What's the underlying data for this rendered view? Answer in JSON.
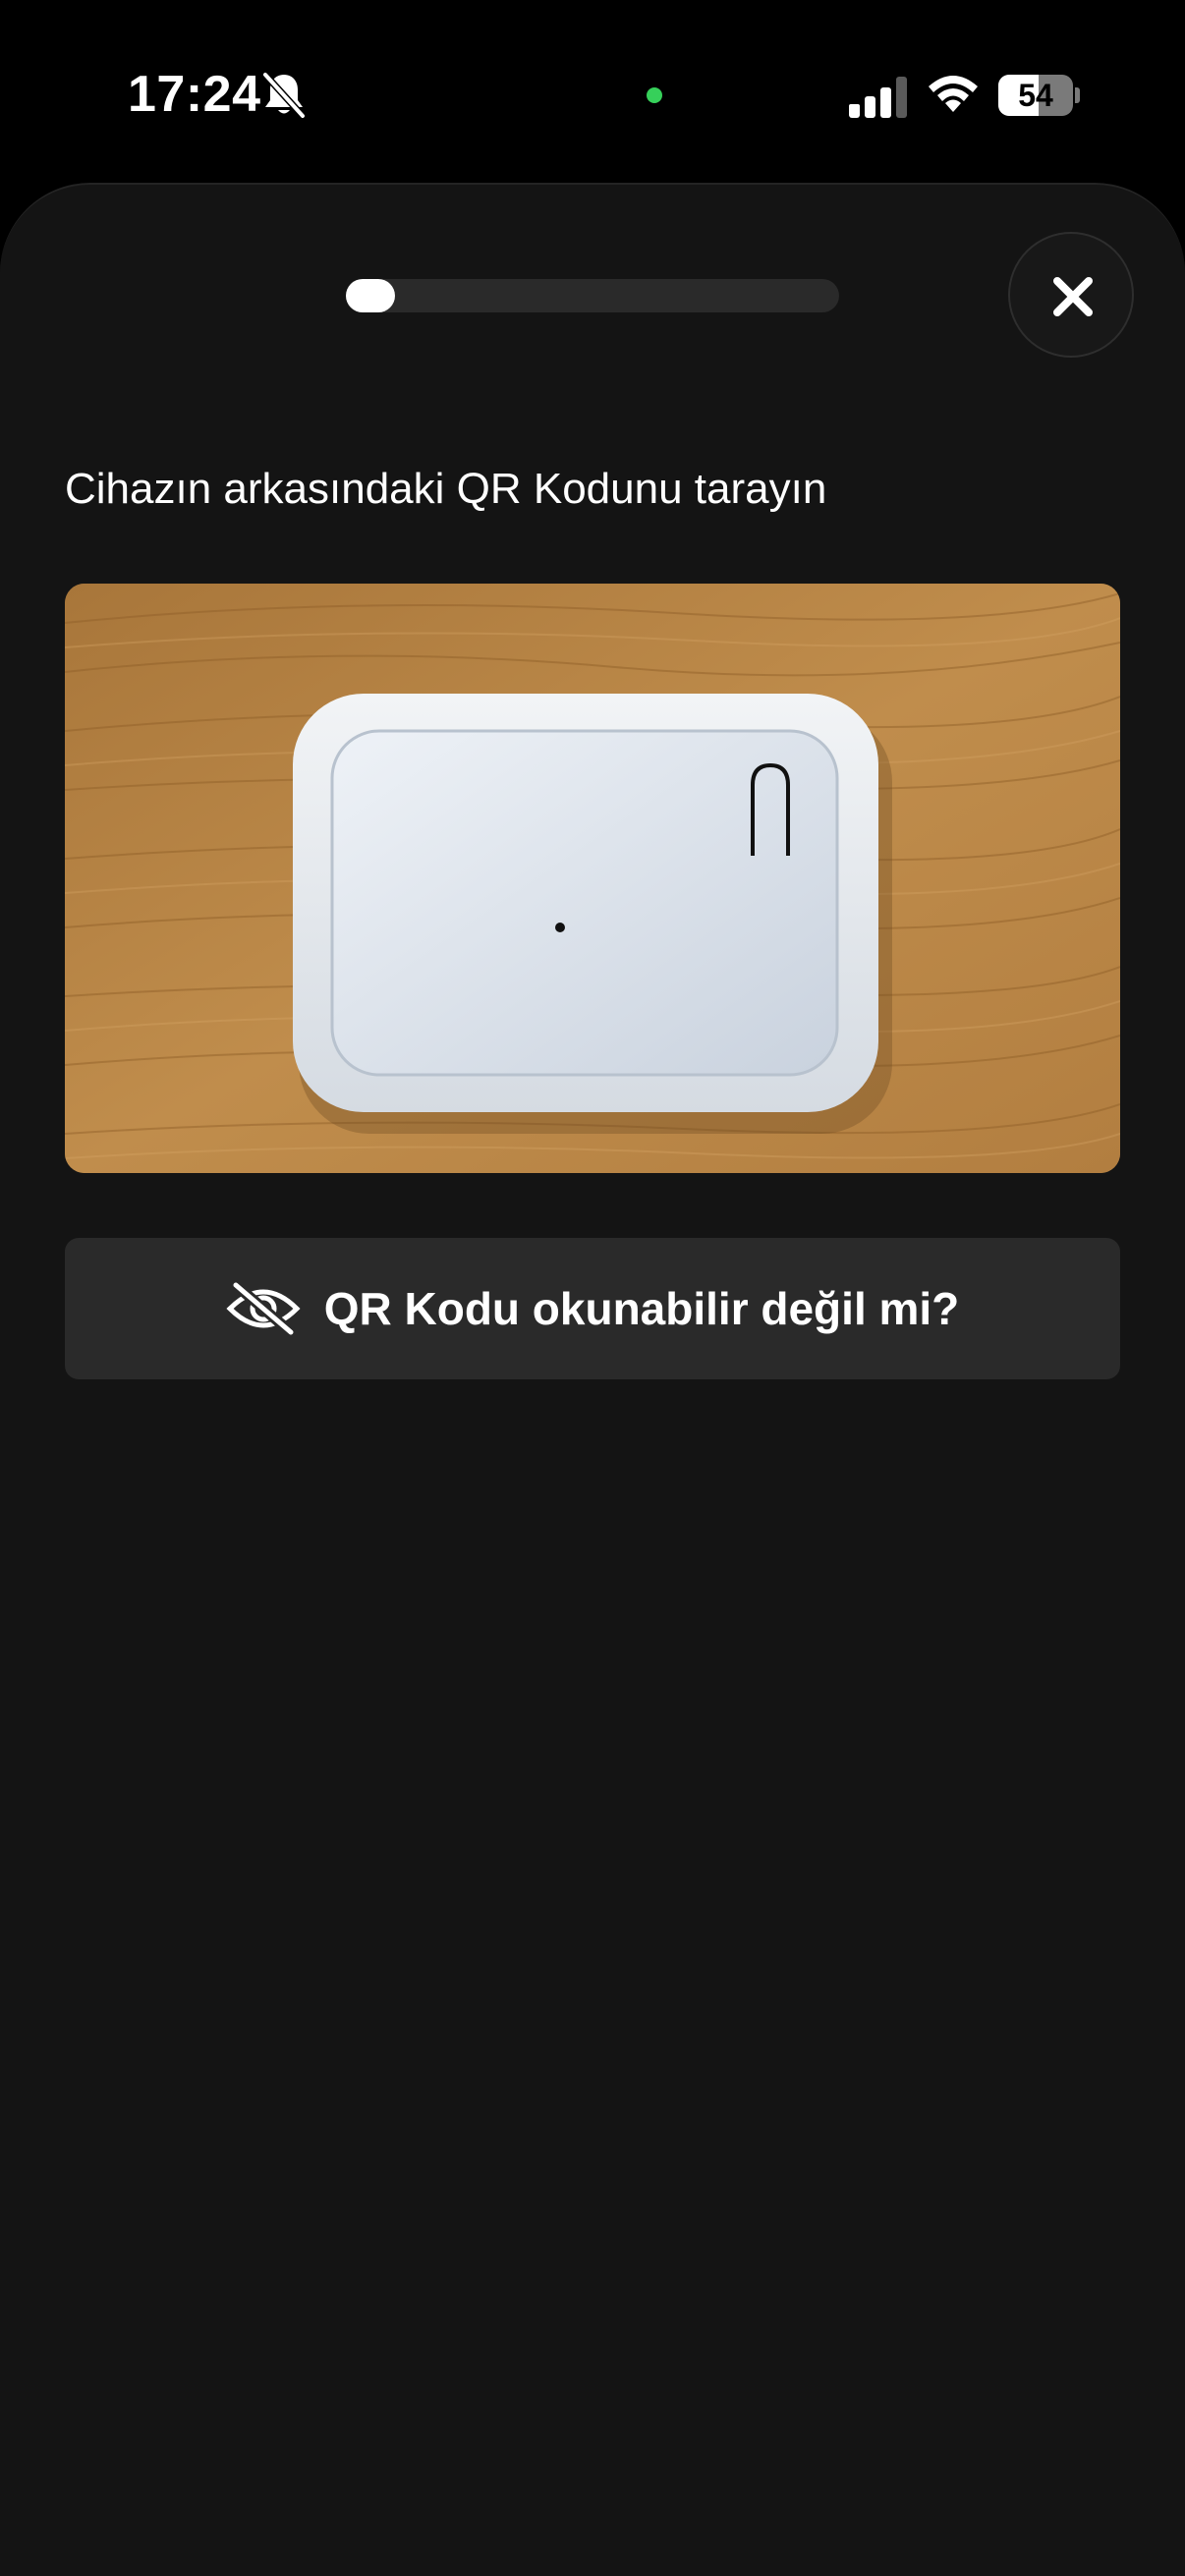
{
  "status_bar": {
    "time": "17:24",
    "battery_level": "54",
    "icons": [
      "bell-slash-icon",
      "signal-icon",
      "wifi-icon",
      "battery-icon"
    ]
  },
  "progress": {
    "step_fraction": 0.1
  },
  "close": {
    "icon": "close-icon"
  },
  "main": {
    "instruction": "Cihazın arkasındaki QR Kodunu tarayın",
    "photo_icon": "device-photo"
  },
  "help": {
    "label": "QR Kodu okunabilir değil mi?",
    "icon": "eye-slash-icon"
  },
  "colors": {
    "background": "#141414",
    "button": "#2a2a2a",
    "text": "#ffffff",
    "camera_indicator": "#36d05a"
  }
}
